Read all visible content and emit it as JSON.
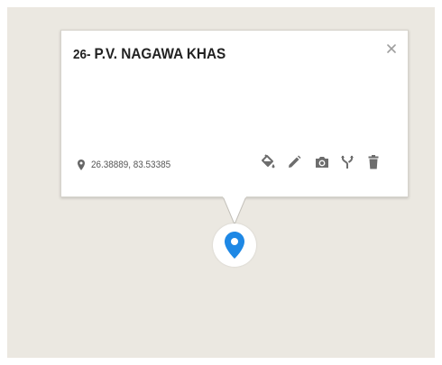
{
  "popup": {
    "number": "26-",
    "title": "P.V. NAGAWA KHAS",
    "close_label": "×",
    "coordinates": "26.38889, 83.53385"
  },
  "toolbar": {
    "icons": [
      "paint-bucket-icon",
      "pencil-icon",
      "camera-icon",
      "fork-icon",
      "trash-icon"
    ]
  },
  "marker": {
    "icon": "map-pin-icon",
    "color": "#1e88e5"
  },
  "colors": {
    "map_background": "#ebe8e1",
    "icon_gray": "#6d6d6d"
  }
}
